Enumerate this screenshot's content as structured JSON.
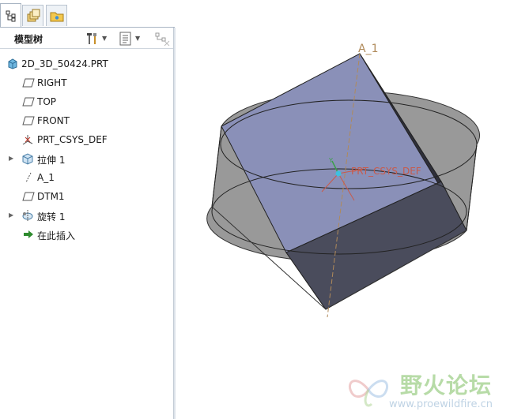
{
  "panel": {
    "title": "模型树"
  },
  "tabs": [
    {
      "icon": "model-tree-icon",
      "active": true
    },
    {
      "icon": "layers-icon",
      "active": false
    },
    {
      "icon": "folder-icon",
      "active": false
    }
  ],
  "tree": {
    "items": [
      {
        "label": "2D_3D_50424.PRT",
        "icon": "part-icon",
        "expandable": false
      },
      {
        "label": "RIGHT",
        "icon": "datum-plane-icon",
        "expandable": false
      },
      {
        "label": "TOP",
        "icon": "datum-plane-icon",
        "expandable": false
      },
      {
        "label": "FRONT",
        "icon": "datum-plane-icon",
        "expandable": false
      },
      {
        "label": "PRT_CSYS_DEF",
        "icon": "coordinate-system-icon",
        "expandable": false
      },
      {
        "label": "拉伸 1",
        "icon": "extrude-icon",
        "expandable": true
      },
      {
        "label": "A_1",
        "icon": "datum-axis-icon",
        "expandable": false
      },
      {
        "label": "DTM1",
        "icon": "datum-plane-icon",
        "expandable": false
      },
      {
        "label": "旋转 1",
        "icon": "revolve-icon",
        "expandable": true
      },
      {
        "label": "在此插入",
        "icon": "insert-here-arrow-icon",
        "expandable": false
      }
    ]
  },
  "viewport": {
    "axis_label": "A_1",
    "csys_label": "PRT_CSYS_DEF",
    "colors": {
      "cube_face": "#8a90b8",
      "cube_dark": "#3f4150",
      "cylinder": "#7c7c7c",
      "axis": "#b08a5a",
      "csys": "#c85a4a"
    }
  },
  "watermark": {
    "name": "野火论坛",
    "url": "www.proewildfire.cn"
  }
}
